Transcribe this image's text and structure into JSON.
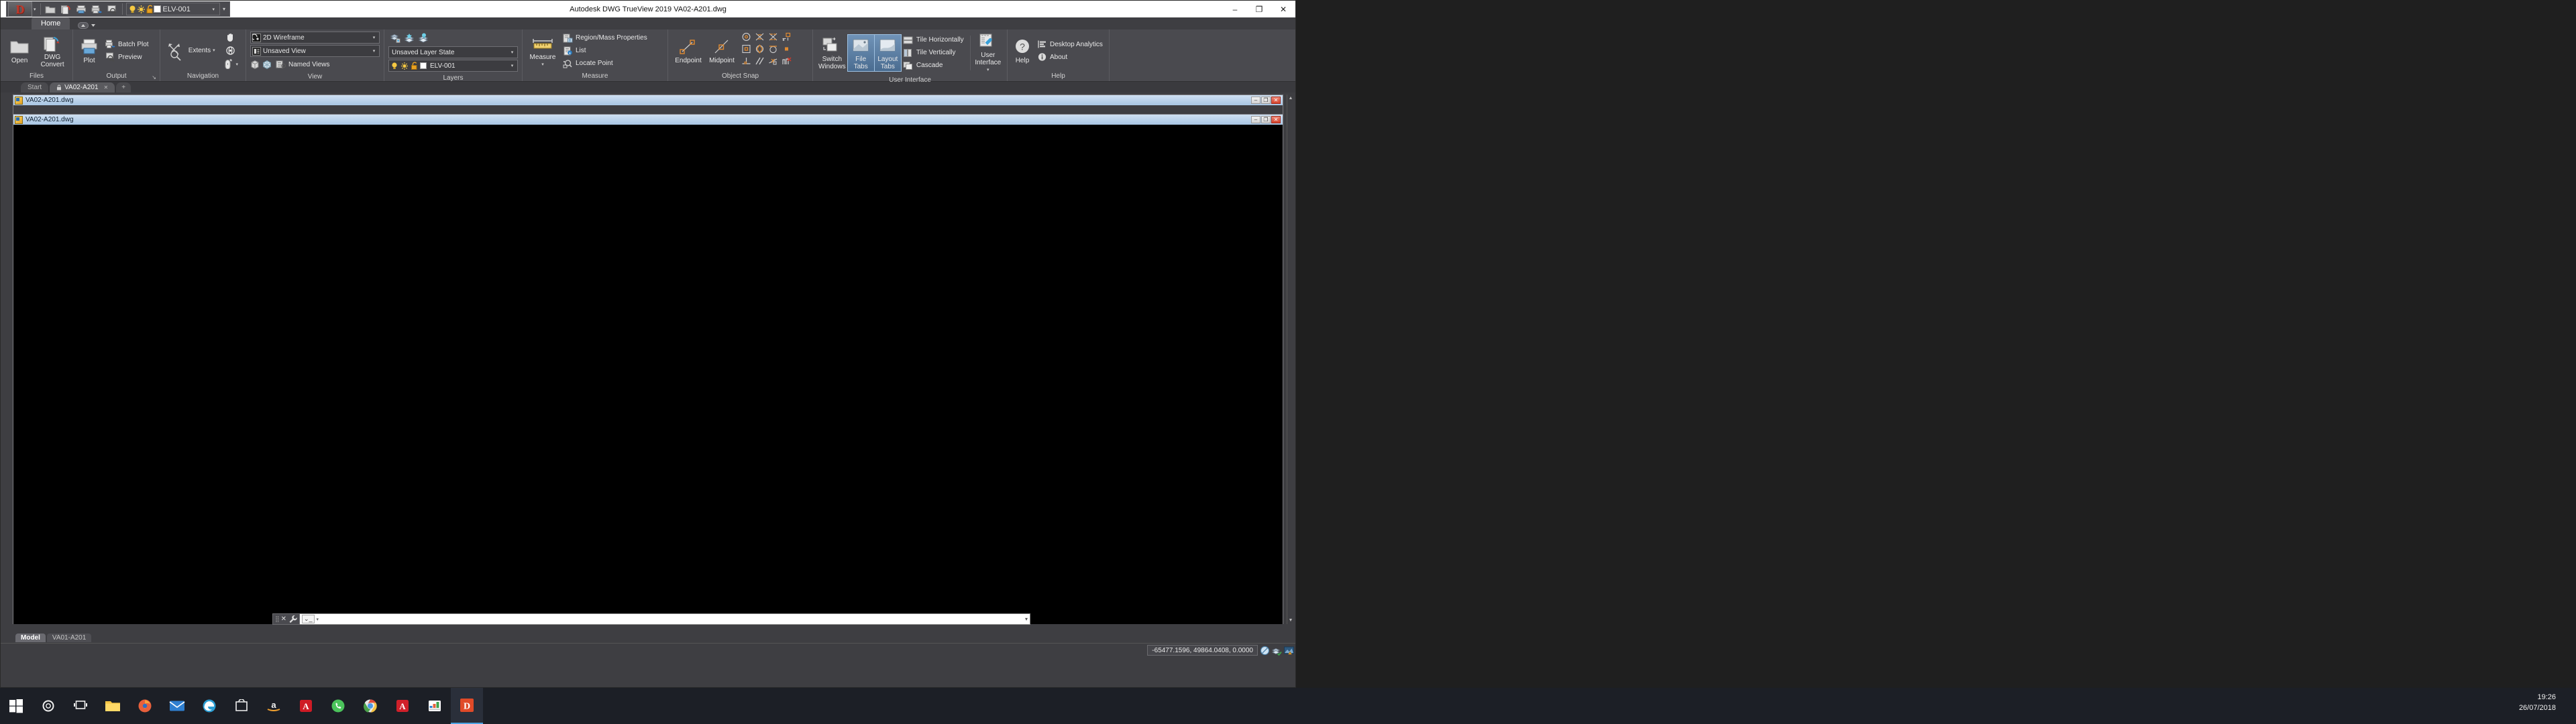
{
  "window": {
    "title": "Autodesk DWG TrueView 2019   VA02-A201.dwg",
    "minimize": "–",
    "maximize": "❐",
    "close": "✕"
  },
  "quick_access": {
    "logo_letter": "D",
    "logo_caret": "▾",
    "buttons": [
      {
        "name": "open-icon",
        "glyph": "📂"
      },
      {
        "name": "publish-icon",
        "glyph": "🗐"
      },
      {
        "name": "plot-icon",
        "glyph": "🖨"
      },
      {
        "name": "batch-plot-icon",
        "glyph": "🖨"
      },
      {
        "name": "preview-icon",
        "glyph": "🔍"
      }
    ],
    "layer_controls": {
      "lightbulb": "💡",
      "sun": "☀",
      "unlock": "🔓",
      "color_swatch": "",
      "layer_name": "ELV-001",
      "dropdown_caret": "▾",
      "overflow_caret": "▾"
    }
  },
  "ribbon": {
    "tabs": [
      {
        "label": "Home",
        "active": true
      }
    ],
    "minimize_caret": "▾",
    "panels": [
      {
        "title": "Files",
        "dialog_launcher": "",
        "big_buttons": [
          {
            "label": "Open",
            "icon": "folder-icon"
          },
          {
            "label": "DWG\nConvert",
            "label_line1": "DWG",
            "label_line2": "Convert",
            "icon": "dwg-convert-icon"
          }
        ]
      },
      {
        "title": "Output",
        "dialog_launcher": "↘",
        "big_buttons": [
          {
            "label": "Plot",
            "icon": "printer-icon"
          }
        ],
        "small_buttons": [
          {
            "label": "Batch Plot",
            "icon": "batch-plot-icon"
          },
          {
            "label": "Preview",
            "icon": "preview-icon"
          }
        ]
      },
      {
        "title": "Navigation",
        "big_buttons": [
          {
            "label": "Extents",
            "icon": "zoom-extents-icon",
            "caret": "▾"
          }
        ],
        "icons": [
          {
            "name": "pan-hand-icon",
            "glyph": "✋"
          },
          {
            "name": "orbit-icon",
            "glyph": "◍"
          },
          {
            "name": "steering-wheel-icon",
            "glyph": "🖱",
            "caret": "▾"
          }
        ]
      },
      {
        "title": "View",
        "combos": [
          {
            "name": "visual-style-combo",
            "value": "2D Wireframe",
            "caret": "▾"
          },
          {
            "name": "view-combo",
            "value": "Unsaved View",
            "caret": "▾"
          }
        ],
        "small_buttons": [
          {
            "label": "Named Views",
            "icon": "named-views-icon"
          }
        ],
        "icons": [
          {
            "name": "viewcube-icon",
            "glyph": "▮"
          },
          {
            "name": "isometric-view-icon",
            "glyph": "⬡"
          }
        ]
      },
      {
        "title": "Layers",
        "icons": [
          {
            "name": "layer-properties-icon"
          },
          {
            "name": "layer-isolate-icon"
          },
          {
            "name": "layer-unisolate-icon"
          }
        ],
        "combos": [
          {
            "name": "layer-state-combo",
            "value": "Unsaved Layer State",
            "caret": "▾"
          },
          {
            "name": "layer-combo",
            "value": "ELV-001",
            "caret": "▾"
          }
        ]
      },
      {
        "title": "Measure",
        "big_buttons": [
          {
            "label": "Measure",
            "icon": "measure-ruler-icon",
            "caret": "▾"
          }
        ],
        "small_buttons": [
          {
            "label": "Region/Mass Properties",
            "icon": "region-mass-icon"
          },
          {
            "label": "List",
            "icon": "list-icon"
          },
          {
            "label": "Locate Point",
            "icon": "locate-point-icon"
          }
        ]
      },
      {
        "title": "Object Snap",
        "big_buttons": [
          {
            "label": "Endpoint",
            "icon": "osnap-endpoint-icon"
          },
          {
            "label": "Midpoint",
            "icon": "osnap-midpoint-icon"
          }
        ],
        "snap_icons": [
          {
            "name": "osnap-center-icon"
          },
          {
            "name": "osnap-intersection-icon"
          },
          {
            "name": "osnap-apparent-intersection-icon"
          },
          {
            "name": "osnap-extension-icon"
          },
          {
            "name": "osnap-node-icon"
          },
          {
            "name": "osnap-quadrant-icon"
          },
          {
            "name": "osnap-tangent-icon"
          },
          {
            "name": "osnap-insertion-icon"
          },
          {
            "name": "osnap-perpendicular-icon"
          },
          {
            "name": "osnap-parallel-icon"
          },
          {
            "name": "osnap-nearest-icon"
          },
          {
            "name": "osnap-none-icon"
          }
        ]
      },
      {
        "title": "User Interface",
        "big_buttons": [
          {
            "label": "Switch\nWindows",
            "label_line1": "Switch",
            "label_line2": "Windows",
            "icon": "switch-windows-icon",
            "caret": "▾"
          },
          {
            "label": "File Tabs",
            "label_line1": "File Tabs",
            "label_line2": "",
            "icon": "file-tabs-icon",
            "active": true
          },
          {
            "label": "Layout\nTabs",
            "label_line1": "Layout",
            "label_line2": "Tabs",
            "icon": "layout-tabs-icon",
            "active": true
          }
        ],
        "small_buttons": [
          {
            "label": "Tile Horizontally",
            "icon": "tile-horizontally-icon"
          },
          {
            "label": "Tile Vertically",
            "icon": "tile-vertically-icon"
          },
          {
            "label": "Cascade",
            "icon": "cascade-icon"
          }
        ],
        "big_buttons2": [
          {
            "label": "User\nInterface",
            "label_line1": "User",
            "label_line2": "Interface",
            "icon": "user-interface-icon",
            "caret": "▾"
          }
        ]
      },
      {
        "title": "Help",
        "big_buttons": [
          {
            "label": "Help",
            "icon": "help-question-icon"
          }
        ],
        "small_buttons": [
          {
            "label": "Desktop Analytics",
            "icon": "desktop-analytics-icon"
          },
          {
            "label": "About",
            "icon": "about-info-icon"
          }
        ]
      }
    ]
  },
  "file_tabs": [
    {
      "label": "Start",
      "active": false,
      "lock": false,
      "close": ""
    },
    {
      "label": "VA02-A201",
      "active": true,
      "lock": "🔒",
      "close": "✕"
    },
    {
      "label": "+",
      "active": false
    }
  ],
  "documents": [
    {
      "title": "VA02-A201.dwg",
      "buttons": {
        "minimize": "–",
        "maximize": "❐",
        "close": "✕"
      }
    },
    {
      "title": "VA02-A201.dwg",
      "buttons": {
        "minimize": "–",
        "maximize": "❐",
        "close": "✕"
      }
    }
  ],
  "command_line": {
    "close_glyph": "✕",
    "settings_glyph": "🔧",
    "prompt_icon": "⌄_",
    "prompt_caret": "▾",
    "value": "",
    "placeholder": "",
    "overflow_caret": "▾"
  },
  "layout_tabs": [
    {
      "label": "Model",
      "active": true
    },
    {
      "label": "VA01-A201",
      "active": false
    }
  ],
  "status_bar": {
    "coordinates": "-65477.1596, 49864.0408, 0.0000",
    "icons": [
      {
        "name": "no-selection-filter-icon"
      },
      {
        "name": "isolate-objects-icon"
      },
      {
        "name": "hardware-acceleration-icon"
      }
    ]
  },
  "scrollbar": {
    "up_arrow": "▲",
    "down_arrow": "▼"
  },
  "taskbar": {
    "items": [
      {
        "name": "start-button",
        "glyph": "⊞",
        "color": "#ffffff"
      },
      {
        "name": "cortana-search-icon",
        "glyph": "◯",
        "color": "#ffffff"
      },
      {
        "name": "task-view-icon",
        "glyph": "❑",
        "color": "#ffffff"
      },
      {
        "name": "folder-explorer-icon",
        "glyph": "📁",
        "color": "#f0c040"
      },
      {
        "name": "firefox-icon",
        "glyph": "●",
        "color": "#e8603c"
      },
      {
        "name": "mail-icon",
        "glyph": "✉",
        "color": "#3a8fd8"
      },
      {
        "name": "edge-icon",
        "glyph": "e",
        "color": "#2b9ed4"
      },
      {
        "name": "store-icon",
        "glyph": "▣",
        "color": "#ffffff"
      },
      {
        "name": "amazon-icon",
        "glyph": "a",
        "color": "#f0a030"
      },
      {
        "name": "adobe-reader-icon",
        "glyph": "A",
        "color": "#d0202a"
      },
      {
        "name": "whatsapp-icon",
        "glyph": "✆",
        "color": "#4bc35b"
      },
      {
        "name": "chrome-icon",
        "glyph": "◉",
        "color": "#4b9ae8"
      },
      {
        "name": "acrobat-icon",
        "glyph": "A",
        "color": "#d0202a"
      },
      {
        "name": "excel-icon",
        "glyph": "▦",
        "color": "#3fa34d"
      },
      {
        "name": "dwg-trueview-icon",
        "glyph": "D",
        "color": "#e04a28",
        "active": true
      }
    ],
    "clock": {
      "time": "19:26",
      "date": "26/07/2018"
    }
  }
}
